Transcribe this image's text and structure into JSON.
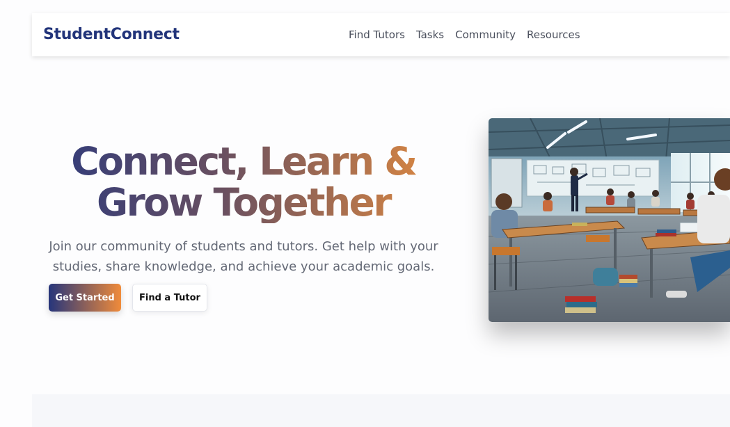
{
  "navbar": {
    "brand": "StudentConnect",
    "links": [
      "Find Tutors",
      "Tasks",
      "Community",
      "Resources"
    ]
  },
  "hero": {
    "title_line1": "Connect, Learn &",
    "title_line2": "Grow Together",
    "subtitle_line1": "Join our community of students and tutors. Get help with your",
    "subtitle_line2": "studies, share knowledge, and achieve your academic goals.",
    "primary_button": "Get Started",
    "secondary_button": "Find a Tutor",
    "image_icon": "classroom-illustration"
  },
  "colors": {
    "brand": "#22347a",
    "gradient_start": "#26357b",
    "gradient_end": "#f08b3a",
    "text_muted": "#636875"
  }
}
